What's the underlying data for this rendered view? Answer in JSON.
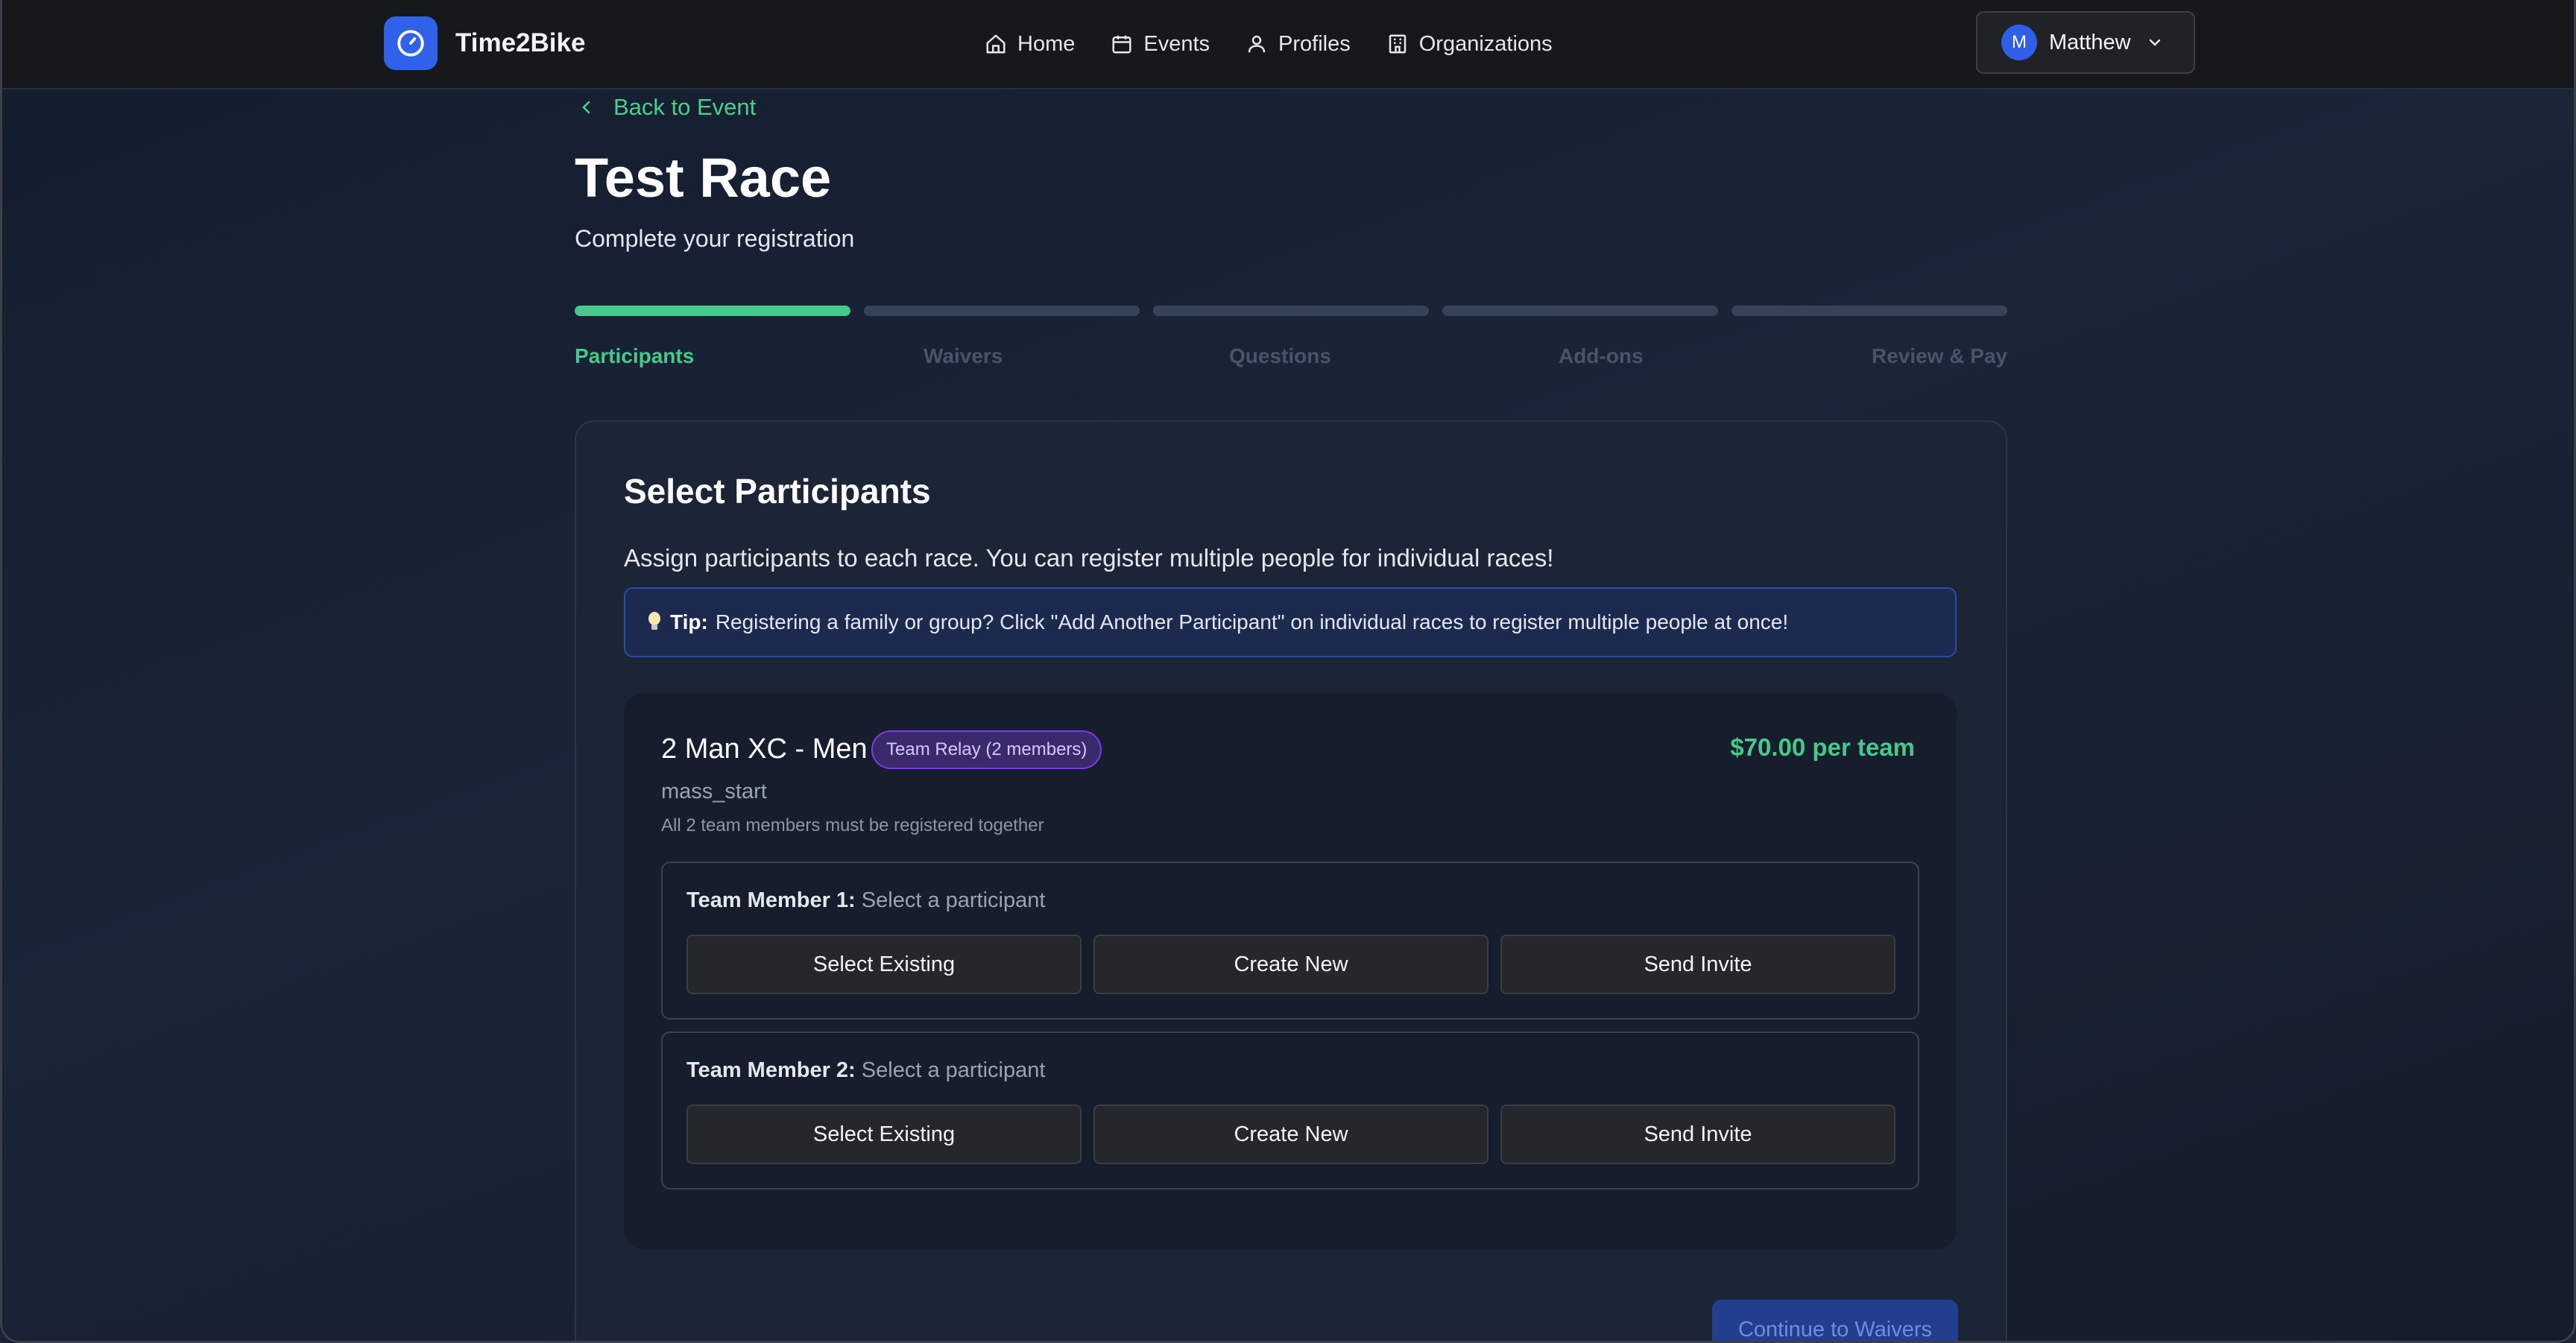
{
  "brand": {
    "name": "Time2Bike",
    "logo_icon": "stopwatch-icon",
    "accent": "#2f62e8"
  },
  "nav": {
    "items": [
      {
        "label": "Home",
        "icon": "home-icon"
      },
      {
        "label": "Events",
        "icon": "calendar-icon"
      },
      {
        "label": "Profiles",
        "icon": "user-icon"
      },
      {
        "label": "Organizations",
        "icon": "building-icon"
      }
    ]
  },
  "user": {
    "initial": "M",
    "name": "Matthew"
  },
  "back_link": "Back to Event",
  "page": {
    "title": "Test Race",
    "subtitle": "Complete your registration"
  },
  "steps": {
    "current": "Participants",
    "items": [
      {
        "label": "Participants",
        "active": true
      },
      {
        "label": "Waivers",
        "active": false
      },
      {
        "label": "Questions",
        "active": false
      },
      {
        "label": "Add-ons",
        "active": false
      },
      {
        "label": "Review & Pay",
        "active": false
      }
    ]
  },
  "card": {
    "title": "Select Participants",
    "description": "Assign participants to each race. You can register multiple people for individual races!",
    "tip_label": "Tip:",
    "tip_text": "Registering a family or group? Click \"Add Another Participant\" on individual races to register multiple people at once!"
  },
  "race": {
    "name": "2 Man XC - Men",
    "badge": "Team Relay (2 members)",
    "price": "$70.00 per team",
    "start_type": "mass_start",
    "note": "All 2 team members must be registered together",
    "members": [
      {
        "label": "Team Member 1:",
        "status": "Select a participant"
      },
      {
        "label": "Team Member 2:",
        "status": "Select a participant"
      }
    ],
    "actions": {
      "select": "Select Existing",
      "create": "Create New",
      "invite": "Send Invite"
    }
  },
  "continue_button": "Continue to Waivers",
  "colors": {
    "success": "#46c98a",
    "badge": "#7c3aed"
  }
}
